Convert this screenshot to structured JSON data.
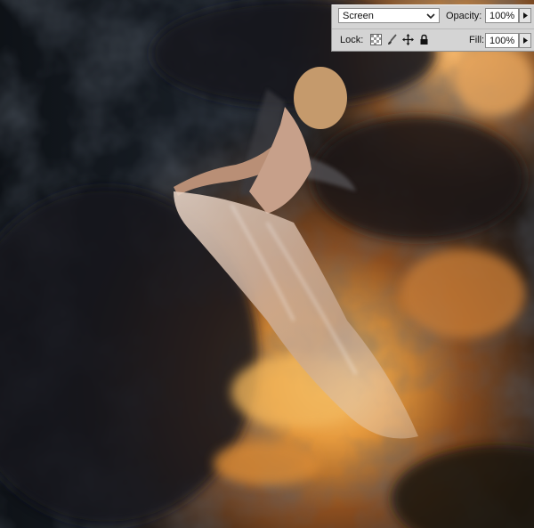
{
  "layers_panel": {
    "blend_mode": "Screen",
    "opacity_label": "Opacity:",
    "opacity_value": "100%",
    "lock_label": "Lock:",
    "fill_label": "Fill:",
    "fill_value": "100%"
  },
  "icons": {
    "blend_dropdown": "chevron-down-icon",
    "opacity_menu": "triangle-right-icon",
    "fill_menu": "triangle-right-icon",
    "lock_pixels": "checkerboard-icon",
    "lock_paint": "brush-icon",
    "lock_position": "move-arrows-icon",
    "lock_all": "padlock-icon"
  },
  "colors": {
    "panel_bg": "#d4d4d4",
    "field_bg": "#ffffff",
    "sky_dark": "#10141a",
    "cloud_glow": "#f0a64a"
  }
}
